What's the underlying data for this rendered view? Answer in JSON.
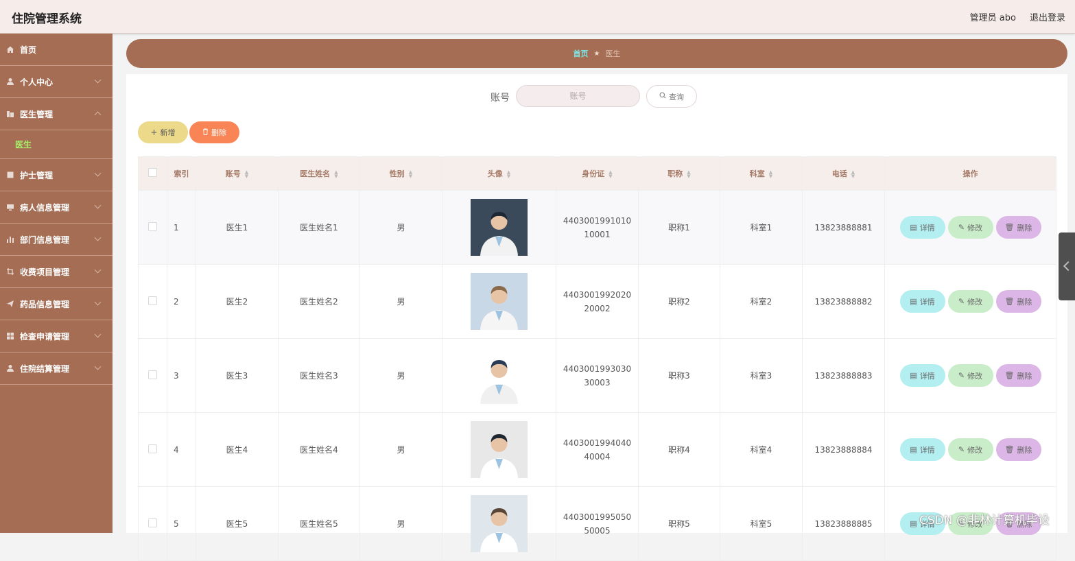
{
  "app": {
    "title": "住院管理系统"
  },
  "header": {
    "user_label": "管理员 abo",
    "logout_label": "退出登录"
  },
  "sidebar": {
    "items": [
      {
        "label": "首页",
        "icon": "home-icon",
        "expandable": false
      },
      {
        "label": "个人中心",
        "icon": "user-icon",
        "expandable": true
      },
      {
        "label": "医生管理",
        "icon": "building-icon",
        "expandable": true,
        "expanded": true,
        "children": [
          "医生"
        ]
      },
      {
        "label": "护士管理",
        "icon": "clipboard-icon",
        "expandable": true
      },
      {
        "label": "病人信息管理",
        "icon": "monitor-icon",
        "expandable": true
      },
      {
        "label": "部门信息管理",
        "icon": "bar-chart-icon",
        "expandable": true
      },
      {
        "label": "收费项目管理",
        "icon": "crop-icon",
        "expandable": true
      },
      {
        "label": "药品信息管理",
        "icon": "send-icon",
        "expandable": true
      },
      {
        "label": "检查申请管理",
        "icon": "grid-icon",
        "expandable": true
      },
      {
        "label": "住院结算管理",
        "icon": "user-icon",
        "expandable": true
      }
    ],
    "active_child": "医生"
  },
  "breadcrumb": {
    "home": "首页",
    "current": "医生"
  },
  "search": {
    "label": "账号",
    "placeholder": "账号",
    "button": "查询"
  },
  "toolbar": {
    "add_label": "新增",
    "delete_label": "删除"
  },
  "table": {
    "columns": [
      "索引",
      "账号",
      "医生姓名",
      "性别",
      "头像",
      "身份证",
      "职称",
      "科室",
      "电话",
      "操作"
    ],
    "rows": [
      {
        "index": "1",
        "account": "医生1",
        "name": "医生姓名1",
        "gender": "男",
        "id_card": "440300199101010001",
        "title": "职称1",
        "dept": "科室1",
        "phone": "13823888881"
      },
      {
        "index": "2",
        "account": "医生2",
        "name": "医生姓名2",
        "gender": "男",
        "id_card": "440300199202020002",
        "title": "职称2",
        "dept": "科室2",
        "phone": "13823888882"
      },
      {
        "index": "3",
        "account": "医生3",
        "name": "医生姓名3",
        "gender": "男",
        "id_card": "440300199303030003",
        "title": "职称3",
        "dept": "科室3",
        "phone": "13823888883"
      },
      {
        "index": "4",
        "account": "医生4",
        "name": "医生姓名4",
        "gender": "男",
        "id_card": "440300199404040004",
        "title": "职称4",
        "dept": "科室4",
        "phone": "13823888884"
      },
      {
        "index": "5",
        "account": "医生5",
        "name": "医生姓名5",
        "gender": "男",
        "id_card": "440300199505050005",
        "title": "职称5",
        "dept": "科室5",
        "phone": "13823888885"
      }
    ],
    "actions": {
      "detail": "详情",
      "edit": "修改",
      "delete": "删除"
    }
  },
  "watermark": "CSDN @非林计算机毕设",
  "colors": {
    "sidebar": "#a46d54",
    "topbar": "#f6ecea",
    "active_sub": "#a8f06a",
    "breadcrumb_home": "#7de6e6",
    "add": "#ecd98a",
    "delete": "#f98556",
    "detail": "#b3eef0",
    "edit": "#c9ecc9",
    "row_delete": "#dcb6e6"
  }
}
